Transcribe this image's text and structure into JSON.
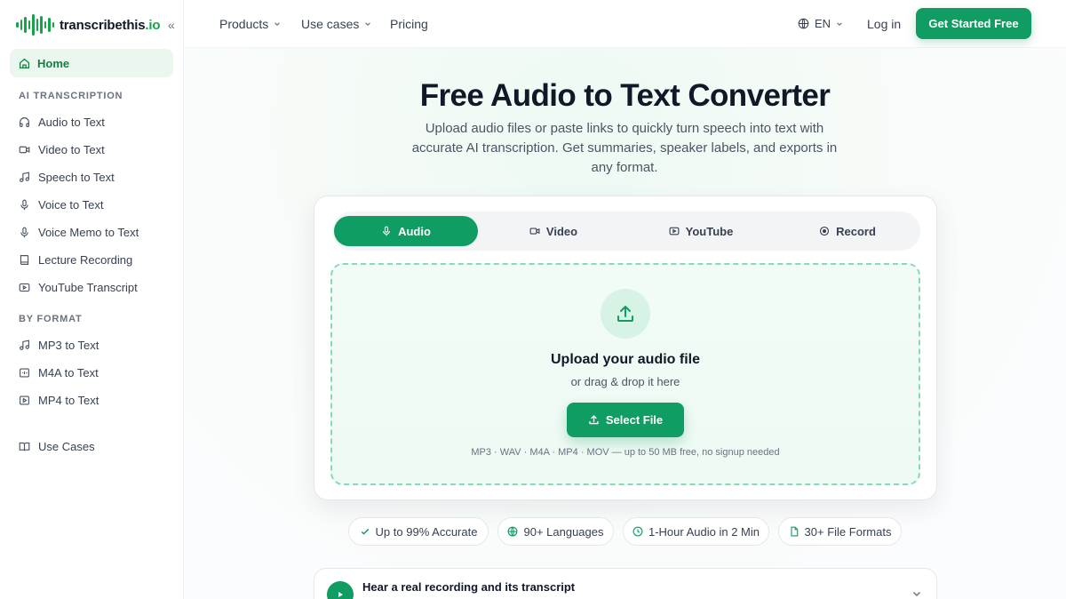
{
  "brand": {
    "name": "transcribethis",
    "tld": ".io",
    "color": "#0f9d63"
  },
  "sidebar": {
    "collapse_label": "«",
    "home": "Home",
    "sections": [
      {
        "label": "AI TRANSCRIPTION",
        "items": [
          {
            "label": "Audio to Text",
            "icon": "headphones-icon"
          },
          {
            "label": "Video to Text",
            "icon": "video-icon"
          },
          {
            "label": "Speech to Text",
            "icon": "music-note-icon"
          },
          {
            "label": "Voice to Text",
            "icon": "microphone-icon"
          },
          {
            "label": "Voice Memo to Text",
            "icon": "microphone-icon"
          },
          {
            "label": "Lecture Recording",
            "icon": "book-icon"
          },
          {
            "label": "YouTube Transcript",
            "icon": "youtube-icon"
          }
        ]
      },
      {
        "label": "BY FORMAT",
        "items": [
          {
            "label": "MP3 to Text",
            "icon": "music-note-icon"
          },
          {
            "label": "M4A to Text",
            "icon": "file-audio-icon"
          },
          {
            "label": "MP4 to Text",
            "icon": "play-box-icon"
          }
        ]
      }
    ],
    "use_cases": "Use Cases"
  },
  "header": {
    "nav": [
      {
        "label": "Products",
        "dropdown": true
      },
      {
        "label": "Use cases",
        "dropdown": true
      },
      {
        "label": "Pricing",
        "dropdown": false
      }
    ],
    "language": "EN",
    "login": "Log in",
    "cta": "Get Started Free"
  },
  "hero": {
    "title": "Free Audio to Text Converter",
    "subtitle": "Upload audio files or paste links to quickly turn speech into text with accurate AI transcription. Get summaries, speaker labels, and exports in any format."
  },
  "upload_card": {
    "tabs": [
      {
        "label": "Audio",
        "icon": "microphone-icon",
        "active": true
      },
      {
        "label": "Video",
        "icon": "video-icon",
        "active": false
      },
      {
        "label": "YouTube",
        "icon": "youtube-icon",
        "active": false
      },
      {
        "label": "Record",
        "icon": "record-icon",
        "active": false
      }
    ],
    "title": "Upload your audio file",
    "subtitle": "or drag & drop it here",
    "button": "Select File",
    "formats": "MP3 · WAV · M4A · MP4 · MOV — up to 50 MB free, no signup needed"
  },
  "badges": [
    {
      "label": "Up to 99% Accurate",
      "icon": "check-icon"
    },
    {
      "label": "90+ Languages",
      "icon": "globe-icon"
    },
    {
      "label": "1-Hour Audio in 2 Min",
      "icon": "clock-icon"
    },
    {
      "label": "30+ File Formats",
      "icon": "file-icon"
    }
  ],
  "sample": {
    "title": "Hear a real recording and its transcript"
  }
}
